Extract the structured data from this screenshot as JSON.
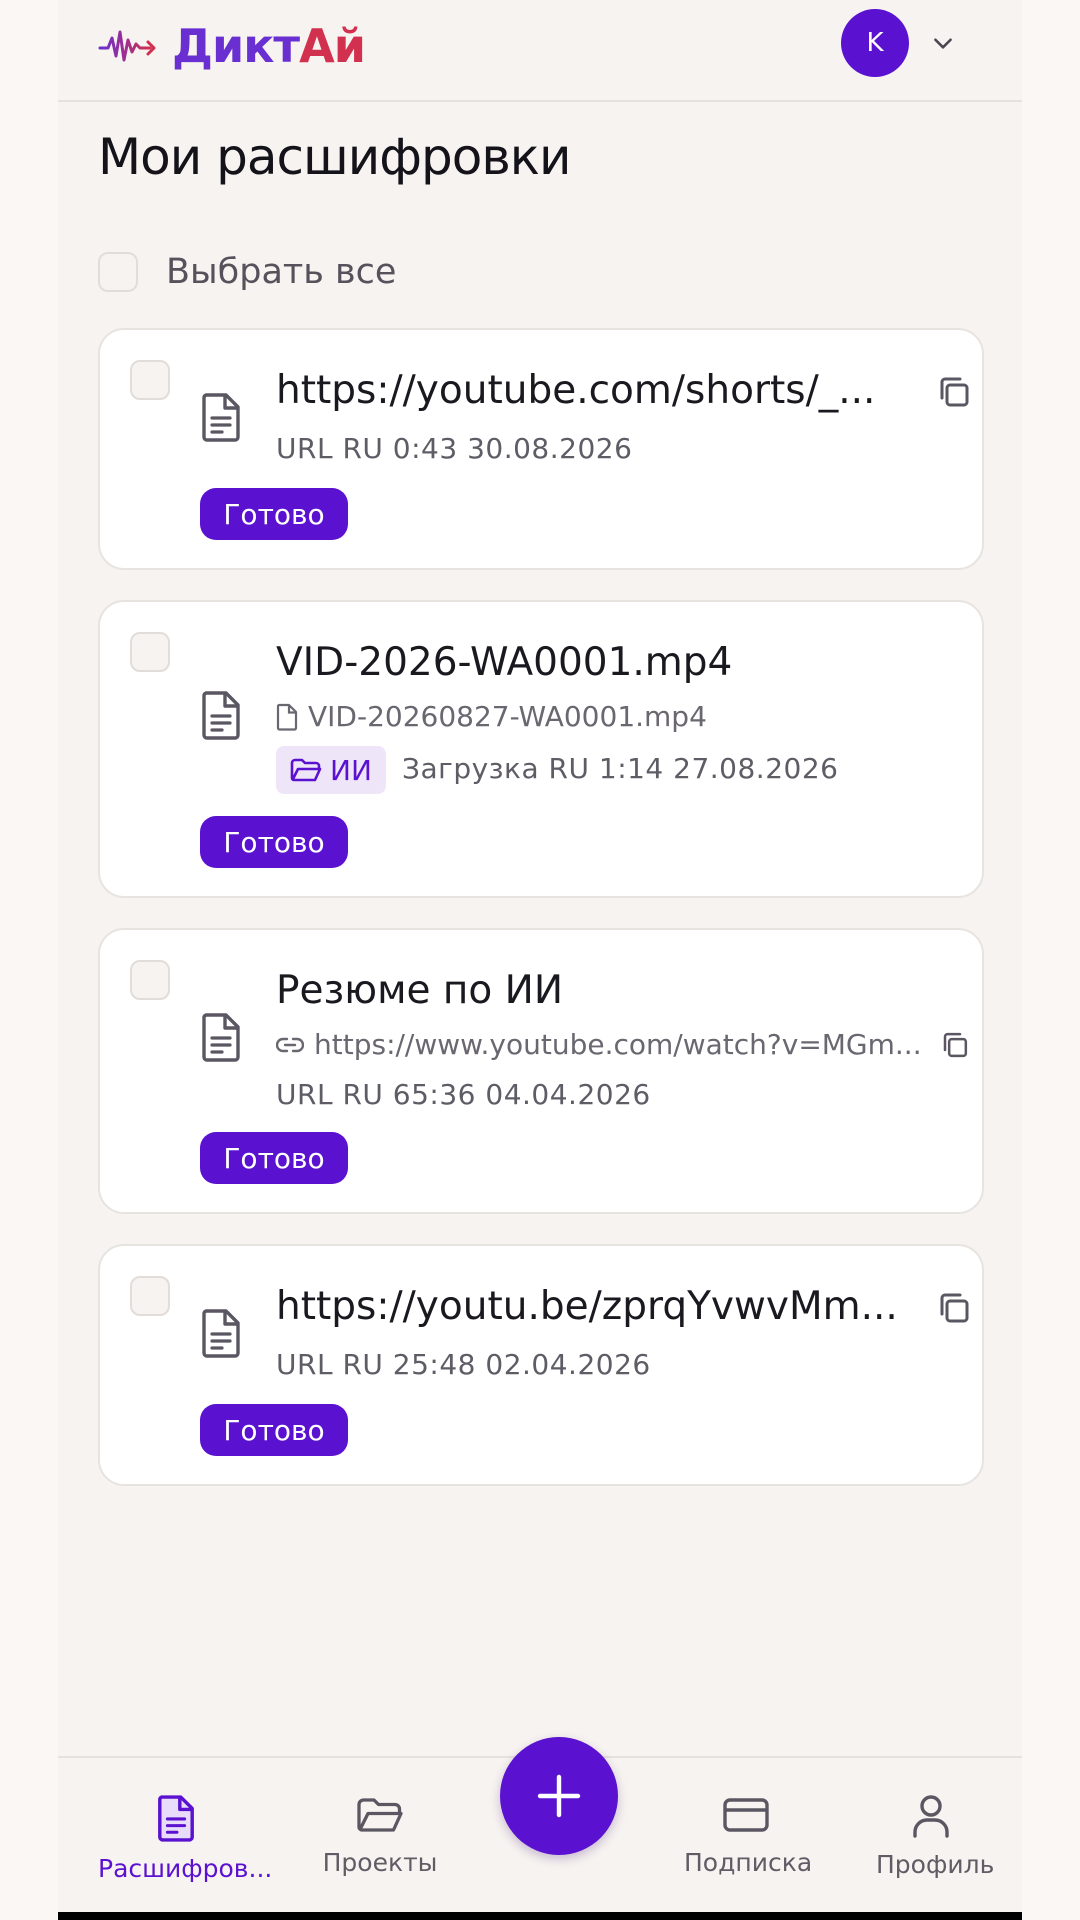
{
  "app": {
    "logo_part1": "Дикт",
    "logo_part2": "Ай",
    "avatar_initial": "K"
  },
  "page": {
    "title": "Мои расшифровки",
    "select_all_label": "Выбрать все"
  },
  "items": [
    {
      "title": "https://youtube.com/shorts/_...",
      "meta": "URL  RU  0:43  30.08.2026",
      "status": "Готово"
    },
    {
      "title": "VID-2026-WA0001.mp4",
      "filename": "VID-20260827-WA0001.mp4",
      "folder": "ИИ",
      "meta": "Загрузка  RU  1:14  27.08.2026",
      "status": "Готово"
    },
    {
      "title": "Резюме по ИИ",
      "link": "https://www.youtube.com/watch?v=MGm...",
      "meta": "URL  RU  65:36  04.04.2026",
      "status": "Готово"
    },
    {
      "title": "https://youtu.be/zprqYvwvMm...",
      "meta": "URL  RU  25:48  02.04.2026",
      "status": "Готово"
    }
  ],
  "nav": {
    "transcripts": "Расшифров...",
    "projects": "Проекты",
    "subscription": "Подписка",
    "profile": "Профиль"
  },
  "colors": {
    "accent": "#5a12d0",
    "logo_red": "#d1304f",
    "tag_bg": "#eee6f8"
  },
  "icons": [
    "waveform-logo-icon",
    "chevron-down-icon",
    "document-icon",
    "copy-icon",
    "file-icon",
    "link-icon",
    "folder-icon",
    "plus-icon",
    "credit-card-icon",
    "user-icon"
  ]
}
